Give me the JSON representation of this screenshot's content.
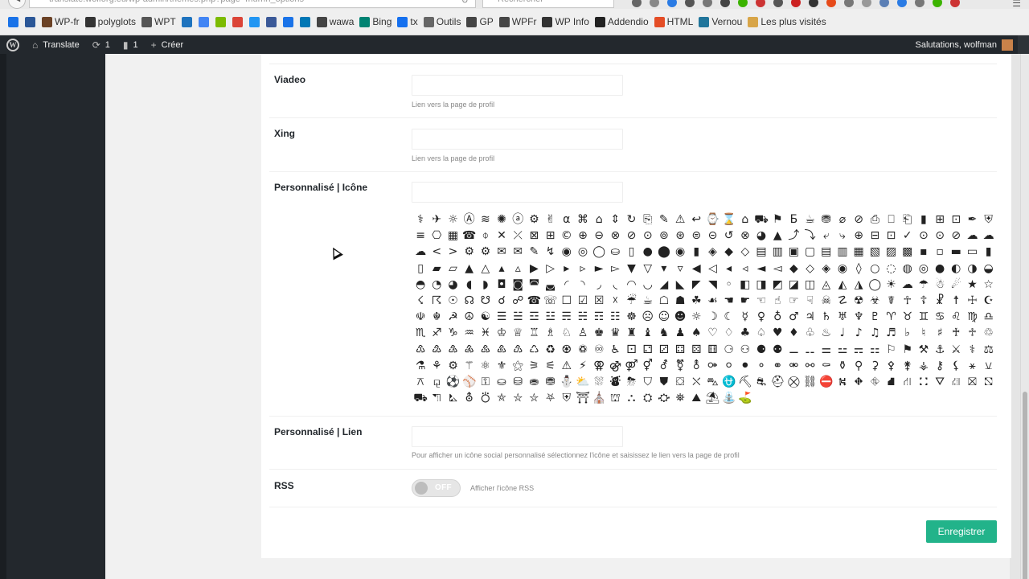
{
  "browser": {
    "url": "translate.wolforg.eu/wp-admin/themes.php?page=murrin_options",
    "search_placeholder": "Rechercher",
    "bookmarks": [
      {
        "label": "",
        "color": "#1a73e8"
      },
      {
        "label": "",
        "color": "#2b5797"
      },
      {
        "label": "WP-fr",
        "color": "#6b4226"
      },
      {
        "label": "polyglots",
        "color": "#333333"
      },
      {
        "label": "WPT",
        "color": "#555555"
      },
      {
        "label": "",
        "color": "#1e73be"
      },
      {
        "label": "",
        "color": "#4285f4"
      },
      {
        "label": "",
        "color": "#7cbb00"
      },
      {
        "label": "",
        "color": "#db4437"
      },
      {
        "label": "",
        "color": "#2196f3"
      },
      {
        "label": "",
        "color": "#3b5998"
      },
      {
        "label": "",
        "color": "#1a73e8"
      },
      {
        "label": "",
        "color": "#0077b5"
      },
      {
        "label": "wawa",
        "color": "#444444"
      },
      {
        "label": "Bing",
        "color": "#008373"
      },
      {
        "label": "tx",
        "color": "#1570ef"
      },
      {
        "label": "Outils",
        "color": "#666666"
      },
      {
        "label": "GP",
        "color": "#444444"
      },
      {
        "label": "WPFr",
        "color": "#464646"
      },
      {
        "label": "WP Info",
        "color": "#333333"
      },
      {
        "label": "Addendio",
        "color": "#222222"
      },
      {
        "label": "HTML",
        "color": "#e44d26"
      },
      {
        "label": "Vernou",
        "color": "#21759b"
      },
      {
        "label": "Les plus visités",
        "color": "#d8a548"
      }
    ]
  },
  "adminbar": {
    "site_name": "Translate",
    "updates_count": "1",
    "comments_count": "1",
    "create_label": "Créer",
    "greeting": "Salutations, wolfman"
  },
  "form": {
    "viadeo": {
      "label": "Viadeo",
      "hint": "Lien vers la page de profil"
    },
    "xing": {
      "label": "Xing",
      "hint": "Lien vers la page de profil"
    },
    "custom_icon": {
      "label": "Personnalisé | Icône"
    },
    "custom_link": {
      "label": "Personnalisé | Lien",
      "hint": "Pour afficher un icône social personnalisé sélectionnez l'icône et saisissez le lien vers la page de profil"
    },
    "rss": {
      "label": "RSS",
      "toggle_state": "OFF",
      "hint": "Afficher l'icône RSS"
    },
    "save_label": "Enregistrer"
  },
  "icon_glyphs": "⚕✈☼Ⓐ≋✺ⓐ⚙✌α⌘⌂⇕↻⎘✎⚠↩⌚⌛⌂⛟⚑Б☕⛃⌀⊘⎙⎕⎗▮⊞⊡✒⛨≡⎔▦☎⌽✕⤫⊠⊞©⊕⊖⊗⊘⊙⊚⊛⊜⊝↺⊗◕▲⤴⤵⤶⤷⊕⊟⊡✓⊙⊙⊘☁☁☁<>⚙⚙✉✉✎↯◉◎◯⛀▯●⬤◉▮◈◆◇▤▥▣▢▤▥▦▧▨▩▪▫▬▭▮▯▰▱▲△▴▵▶▷▸▹►▻▼▽▾▿◀◁◂◃◄◅◆◇◈◉◊○◌◍◎●◐◑◒◓◔◕◖◗◘◙◚◛◜◝◞◟◠◡◢◣◤◥◦◧◨◩◪◫◬◭◮◯☀☁☂☃☄★☆☇☈☉☊☋☌☍☎☏☐☑☒☓☔☕☖☗☘☙☚☛☜☝☞☟☠☡☢☣☤☥☦☧☨☩☪☫☬☭☮☯☰☱☲☳☴☵☶☷☸☹☺☻☼☽☾☿♀♁♂♃♄♅♆♇♈♉♊♋♌♍♎♏♐♑♒♓♔♕♖♗♘♙♚♛♜♝♞♟♠♡♢♣♤♥♦♧♨♩♪♫♬♭♮♯♰♱♲♳♴♵♶♷♸♹♺♻♼♽♾♿⚀⚁⚂⚃⚄⚅⚆⚇⚈⚉⚊⚋⚌⚍⚎⚏⚐⚑⚒⚓⚔⚕⚖⚗⚘⚙⚚⚛⚜⚝⚞⚟⚠⚡⚢⚣⚤⚥⚦⚧⚨⚩⚪⚫⚬⚭⚮⚯⚰⚱⚲⚳⚴⚵⚶⚷⚸⚹⚺⚻⚼⚽⚾⚿⛀⛁⛂⛃⛄⛅⛆⛇⛈⛉⛊⛋⛌⛍⛎⛏⛐⛑⛒⛓⛔⛕⛖⛗⛘⛙⛚⛛⛜⛝⛞⛟⛠⛡⛢⛣⛤⛥⛦⛧⛨⛩⛪⛫⛬⛭⛮⛯⛰⛱⛲⛳⛴⛵⛶⛷⛸⛹⛺⛻⛼⛽⛾⛿✀✁✂✃✄✅✆✇✈✉✊✋✌✍✎✏✐✑✒✓✔✕✖✗✘✙✚✛✜✝✞✟✠✡✢✣✤✥✦✧✨✩✪✫✬✭✮✯✰✱✲✳✴✵✶✷✸✹✺✻✼✽✾✿❀❁❂❃❄❅❆❇❈❉❊❋"
}
